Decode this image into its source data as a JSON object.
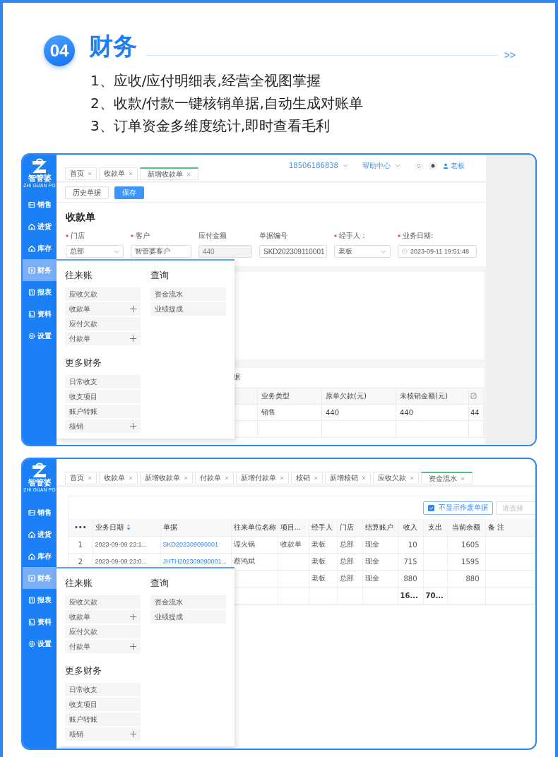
{
  "header": {
    "number": "04",
    "title": "财务",
    "more": ">>",
    "points": [
      "1、应收/应付明细表,经营全视图掌握",
      "2、收款/付款一键核销单据,自动生成对账单",
      "3、订单资金多维度统计,即时查看毛利"
    ]
  },
  "screens": [
    {
      "kind": "receipt_form",
      "logo": {
        "name": "智管婆",
        "subtitle": "ZHI GUAN PO"
      },
      "sidebar": {
        "items": [
          {
            "label": "销售",
            "selected": false
          },
          {
            "label": "进货",
            "selected": false
          },
          {
            "label": "库存",
            "selected": false
          },
          {
            "label": "财务",
            "selected": true
          },
          {
            "label": "报表",
            "selected": false
          },
          {
            "label": "资料",
            "selected": false
          },
          {
            "label": "设置",
            "selected": false
          }
        ]
      },
      "tabs": [
        {
          "label": "首页",
          "selected": false
        },
        {
          "label": "收款单",
          "selected": false
        },
        {
          "label": "新增收款单",
          "selected": true
        }
      ],
      "top_bar": {
        "phone": "18506186838",
        "help": "帮助中心",
        "user": "老板"
      },
      "toolbar": {
        "buttons": [
          {
            "label": "历史单据",
            "kind": "default"
          },
          {
            "label": "保存",
            "kind": "primary"
          }
        ]
      },
      "form": {
        "title": "收款单",
        "fields": [
          {
            "label": "门店",
            "required": true,
            "kind": "select",
            "value": "总部",
            "disabled": false
          },
          {
            "label": "客户",
            "required": true,
            "kind": "text",
            "value": "智管婆客户",
            "disabled": false
          },
          {
            "label": "应付金额",
            "required": false,
            "kind": "text",
            "value": "440",
            "disabled": true
          },
          {
            "label": "单据编号",
            "required": false,
            "kind": "text",
            "value": "SKD202309110001",
            "disabled": false
          },
          {
            "label": "经手人：",
            "required": true,
            "kind": "select",
            "value": "老板",
            "disabled": false
          },
          {
            "label": "业务日期:",
            "required": true,
            "kind": "date",
            "value": "2023-09-11 19:51:48",
            "disabled": false
          }
        ]
      },
      "table": {
        "title": "据",
        "columns": [
          "业务类型",
          "原单欠款(元)",
          "未核销金额(元)"
        ],
        "rows": [
          {
            "cells": [
              "销售",
              "440",
              "440",
              "44"
            ]
          }
        ]
      },
      "menu": {
        "columns": [
          [
            {
              "title": "往来账",
              "items": [
                {
                  "label": "应收欠款",
                  "addable": false
                },
                {
                  "label": "收款单",
                  "addable": true
                },
                {
                  "label": "应付欠款",
                  "addable": false
                },
                {
                  "label": "付款单",
                  "addable": true
                }
              ]
            },
            {
              "title": "更多财务",
              "items": [
                {
                  "label": "日常收支",
                  "addable": false
                },
                {
                  "label": "收支项目",
                  "addable": false
                },
                {
                  "label": "账户转账",
                  "addable": false
                },
                {
                  "label": "核销",
                  "addable": true
                }
              ]
            }
          ],
          [
            {
              "title": "查询",
              "items": [
                {
                  "label": "资金流水",
                  "addable": false
                },
                {
                  "label": "业绩提成",
                  "addable": false
                }
              ]
            }
          ]
        ]
      }
    },
    {
      "kind": "cash_flow",
      "logo": {
        "name": "智管婆",
        "subtitle": "ZHI GUAN PO"
      },
      "sidebar": {
        "items": [
          {
            "label": "销售",
            "selected": false
          },
          {
            "label": "进货",
            "selected": false
          },
          {
            "label": "库存",
            "selected": false
          },
          {
            "label": "财务",
            "selected": true
          },
          {
            "label": "报表",
            "selected": false
          },
          {
            "label": "资料",
            "selected": false
          },
          {
            "label": "设置",
            "selected": false
          }
        ]
      },
      "tabs": [
        {
          "label": "首页",
          "selected": false
        },
        {
          "label": "收款单",
          "selected": false
        },
        {
          "label": "新增收款单",
          "selected": false
        },
        {
          "label": "付款单",
          "selected": false
        },
        {
          "label": "新增付款单",
          "selected": false
        },
        {
          "label": "核销",
          "selected": false
        },
        {
          "label": "新增核销",
          "selected": false
        },
        {
          "label": "应收欠款",
          "selected": false
        },
        {
          "label": "资金流水",
          "selected": true
        }
      ],
      "filter": {
        "checkbox": {
          "label": "不显示作废单据",
          "checked": true
        },
        "select": {
          "placeholder": "请选择"
        }
      },
      "table": {
        "columns": [
          "•••",
          "业务日期",
          "单据",
          "往来单位名称",
          "项目...",
          "经手人",
          "门店",
          "结算账户",
          "收入",
          "支出",
          "当前余额",
          "备 注"
        ],
        "rows": [
          {
            "no": "1",
            "date": "2023-09-09 23:1...",
            "doc": "SKD202309090001",
            "partner": "谭火锅",
            "item": "收款单",
            "handler": "老板",
            "store": "总部",
            "account": "现金",
            "income": "10",
            "balance": "1605"
          },
          {
            "no": "2",
            "date": "2023-09-09 23:0...",
            "doc": "JHTH202309090001...",
            "partner": "蔡鸿斌",
            "handler": "老板",
            "store": "总部",
            "account": "现金",
            "income": "715",
            "balance": "1595"
          },
          {
            "handler": "老板",
            "store": "总部",
            "account": "现金",
            "income": "880",
            "balance": "880"
          }
        ],
        "totals": {
          "income": "16...",
          "expense": "70..."
        }
      },
      "menu": {
        "columns": [
          [
            {
              "title": "往来账",
              "items": [
                {
                  "label": "应收欠款",
                  "addable": false
                },
                {
                  "label": "收款单",
                  "addable": true
                },
                {
                  "label": "应付欠款",
                  "addable": false
                },
                {
                  "label": "付款单",
                  "addable": true
                }
              ]
            },
            {
              "title": "更多财务",
              "items": [
                {
                  "label": "日常收支",
                  "addable": false
                },
                {
                  "label": "收支项目",
                  "addable": false
                },
                {
                  "label": "账户转账",
                  "addable": false
                },
                {
                  "label": "核销",
                  "addable": true
                }
              ]
            }
          ],
          [
            {
              "title": "查询",
              "items": [
                {
                  "label": "资金流水",
                  "addable": false
                },
                {
                  "label": "业绩提成",
                  "addable": false
                }
              ]
            }
          ]
        ]
      }
    }
  ]
}
